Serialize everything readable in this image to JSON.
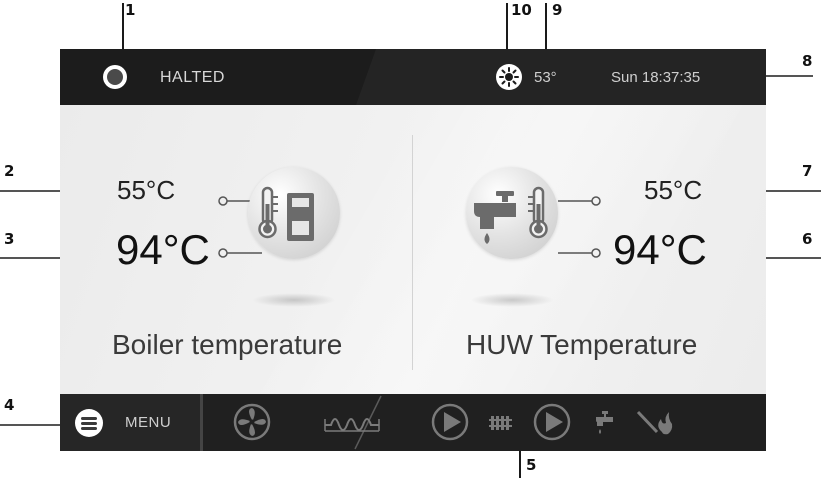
{
  "callouts": [
    "1",
    "2",
    "3",
    "4",
    "5",
    "6",
    "7",
    "8",
    "9",
    "10"
  ],
  "topbar": {
    "status_label": "HALTED",
    "status_icon": "status-indicator-icon",
    "weather_icon": "sun-weather-icon",
    "outdoor_temp": "53°",
    "datetime": "Sun 18:37:35"
  },
  "boiler": {
    "set_temp": "55°C",
    "current_temp": "94°C",
    "label": "Boiler temperature",
    "icon": "boiler-thermometer-icon"
  },
  "huw": {
    "set_temp": "55°C",
    "current_temp": "94°C",
    "label": "HUW Temperature",
    "icon": "tap-thermometer-icon"
  },
  "bottombar": {
    "menu_label": "MENU",
    "menu_icon": "menu-icon",
    "status_icons": [
      "fan-icon",
      "feeder-icon",
      "pump-icon",
      "radiator-icon",
      "pump-icon",
      "tap-icon",
      "igniter-icon"
    ]
  },
  "colors": {
    "bar": "#1c1c1c",
    "panel": "#eeeeee",
    "icon_gray": "#7a7a7a",
    "text_light": "#cfcfcf"
  }
}
